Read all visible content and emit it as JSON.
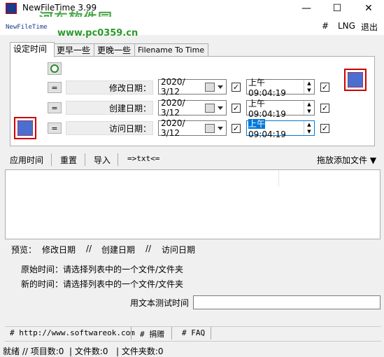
{
  "window": {
    "title": "NewFileTime 3.99",
    "minimize_glyph": "—",
    "maximize_glyph": "☐",
    "close_glyph": "✕"
  },
  "branding": {
    "subtitle": "NewFileTime",
    "watermark": "河东软件园",
    "watermark_url": "www.pc0359.cn"
  },
  "menu": {
    "hash": "#",
    "lng": "LNG",
    "exit": "退出"
  },
  "tabs": [
    {
      "label": "设定时间",
      "active": true
    },
    {
      "label": "更早一些",
      "active": false
    },
    {
      "label": "更晚一些",
      "active": false
    },
    {
      "label": "Filename To Time",
      "active": false
    }
  ],
  "rows": [
    {
      "eq": "=",
      "label": "修改日期：",
      "date": "2020/ 3/12",
      "time": "上午 09:04:19",
      "time_ampm": "上午",
      "time_clock": "09:04:19",
      "date_checked": true,
      "time_checked": true
    },
    {
      "eq": "=",
      "label": "创建日期：",
      "date": "2020/ 3/12",
      "time": "上午 09:04:19",
      "time_ampm": "上午",
      "time_clock": "09:04:19",
      "date_checked": true,
      "time_checked": true
    },
    {
      "eq": "=",
      "label": "访问日期：",
      "date": "2020/ 3/12",
      "time": "上午 09:04:19",
      "time_ampm": "上午",
      "time_clock": "09:04:19",
      "date_checked": true,
      "time_checked": true
    }
  ],
  "check_glyph": "✓",
  "toolbar": {
    "apply": "应用时间",
    "reset": "重置",
    "import": "导入",
    "txt": "=>txt<=",
    "drag_add": "拖放添加文件 ▼"
  },
  "preview": {
    "label": "预览：",
    "modify": "修改日期",
    "sep1": "//",
    "create": "创建日期",
    "sep2": "//",
    "access": "访问日期",
    "original_label": "原始时间：",
    "original_value": "请选择列表中的一个文件/文件夹",
    "new_label": "新的时间：",
    "new_value": "请选择列表中的一个文件/文件夹",
    "test_label": "用文本测试时间",
    "test_value": ""
  },
  "footer": {
    "link1": "# http://www.softwareok.com",
    "link2": "# 捐赠",
    "link3": "# FAQ"
  },
  "status": {
    "text": "就绪 // 项目数:0  | 文件数:0   | 文件夹数:0"
  },
  "colors": {
    "accent": "#0078d7",
    "watermark": "#2a9a2a",
    "icon_red": "#cc0000"
  }
}
